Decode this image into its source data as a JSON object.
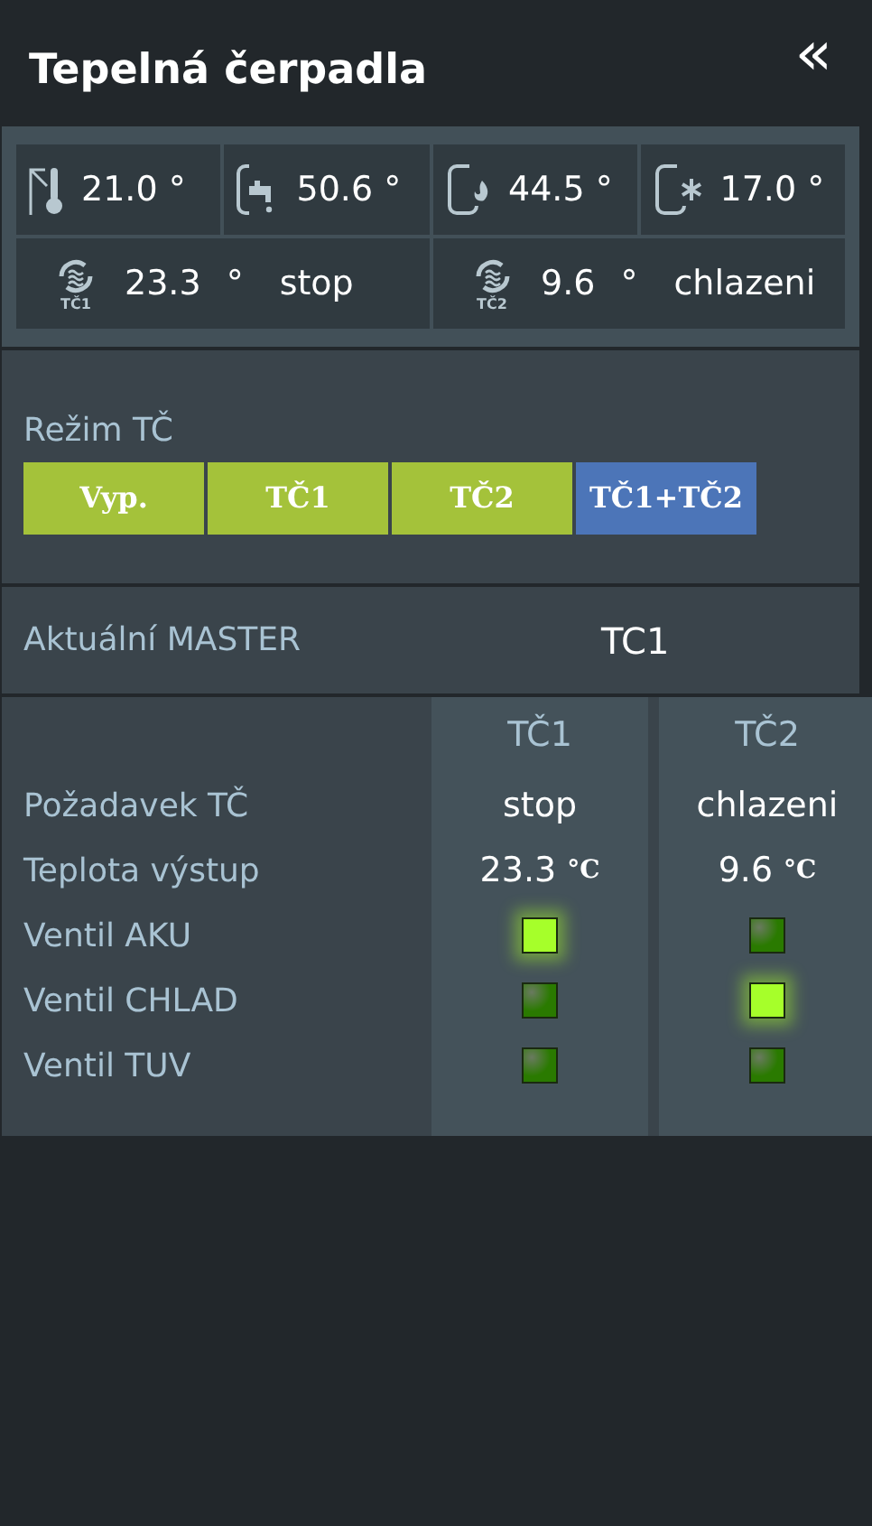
{
  "header": {
    "title": "Tepelná čerpadla",
    "collapse_icon": "«"
  },
  "sensors": [
    {
      "kind": "room",
      "value": "21.0 °"
    },
    {
      "kind": "hot_water",
      "value": "50.6 °"
    },
    {
      "kind": "heat_tank",
      "value": "44.5 °"
    },
    {
      "kind": "cold_tank",
      "value": "17.0 °"
    }
  ],
  "pumps": [
    {
      "icon_label": "TČ1",
      "value": "23.3",
      "unit": "°",
      "status": "stop"
    },
    {
      "icon_label": "TČ2",
      "value": "9.6",
      "unit": "°",
      "status": "chlazeni"
    }
  ],
  "mode": {
    "label": "Režim TČ",
    "buttons": [
      {
        "label": "Vyp.",
        "selected": false
      },
      {
        "label": "TČ1",
        "selected": false
      },
      {
        "label": "TČ2",
        "selected": false
      },
      {
        "label": "TČ1+TČ2",
        "selected": true
      }
    ]
  },
  "master": {
    "label": "Aktuální MASTER",
    "value": "TC1"
  },
  "table": {
    "columns": [
      "TČ1",
      "TČ2"
    ],
    "rows": [
      {
        "kind": "text",
        "label": "Požadavek TČ",
        "cells": [
          {
            "value": "stop"
          },
          {
            "value": "chlazeni"
          }
        ]
      },
      {
        "kind": "temp",
        "label": "Teplota výstup",
        "cells": [
          {
            "value": "23.3",
            "unit": "°C"
          },
          {
            "value": "9.6",
            "unit": "°C"
          }
        ]
      },
      {
        "kind": "lamp",
        "label": "Ventil AKU",
        "cells": [
          {
            "on": true
          },
          {
            "on": false
          }
        ]
      },
      {
        "kind": "lamp",
        "label": "Ventil CHLAD",
        "cells": [
          {
            "on": false
          },
          {
            "on": true
          }
        ]
      },
      {
        "kind": "lamp",
        "label": "Ventil TUV",
        "cells": [
          {
            "on": false
          },
          {
            "on": false
          }
        ]
      }
    ]
  }
}
